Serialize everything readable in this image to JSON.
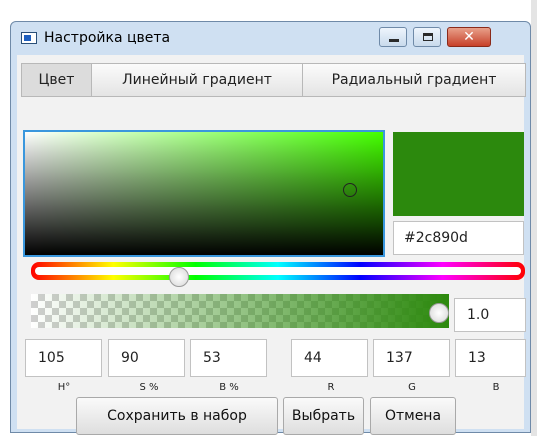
{
  "window": {
    "title": "Настройка цвета",
    "controls": {
      "minimize": "minimize",
      "maximize": "maximize",
      "close": "✕"
    }
  },
  "tabs": [
    {
      "label": "Цвет",
      "active": true
    },
    {
      "label": "Линейный градиент",
      "active": false
    },
    {
      "label": "Радиальный градиент",
      "active": false
    }
  ],
  "color": {
    "hex": "#2c890d",
    "preview_color": "#2c890d",
    "hue_value": 105,
    "saturation_percent": 90,
    "brightness_percent": 53,
    "alpha": "1.0"
  },
  "fields": {
    "h": {
      "value": "105",
      "label": "H°"
    },
    "s": {
      "value": "90",
      "label": "S %"
    },
    "b": {
      "value": "53",
      "label": "B %"
    },
    "r": {
      "value": "44",
      "label": "R"
    },
    "g": {
      "value": "137",
      "label": "G"
    },
    "bl": {
      "value": "13",
      "label": "B"
    }
  },
  "buttons": {
    "save": "Сохранить в набор",
    "select": "Выбрать",
    "cancel": "Отмена"
  },
  "colors": {
    "accent": "#3a97dd",
    "close_button": "#c7412a"
  }
}
